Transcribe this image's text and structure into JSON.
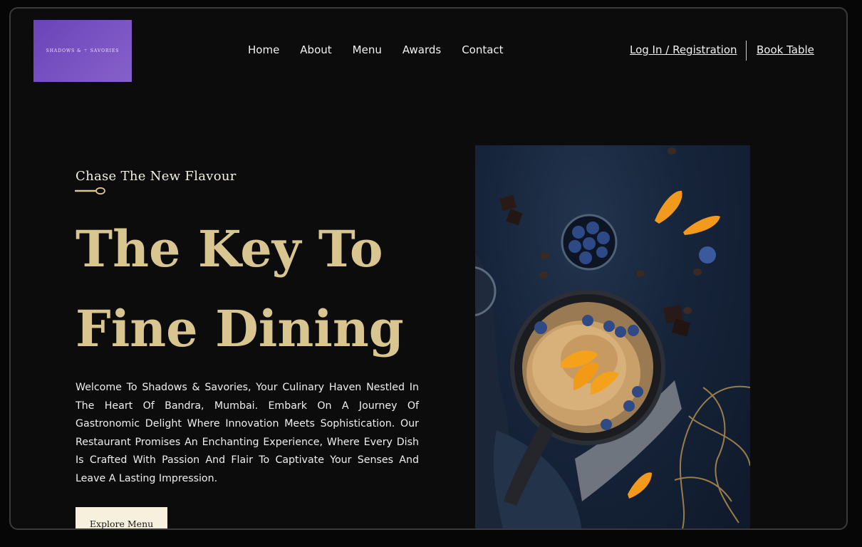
{
  "logo": {
    "text": "SHADOWS & ⚚ SAVORIES",
    "color": "#7450bd"
  },
  "nav": {
    "items": [
      "Home",
      "About",
      "Menu",
      "Awards",
      "Contact"
    ],
    "login_label": "Log In / Registration",
    "book_label": "Book Table"
  },
  "hero": {
    "tagline": "Chase The New Flavour",
    "headline_line1": "The Key To",
    "headline_line2": "Fine Dining",
    "description": "Welcome To Shadows & Savories, Your Culinary Haven Nestled In The Heart Of Bandra, Mumbai. Embark On A Journey Of Gastronomic Delight Where Innovation Meets Sophistication. Our Restaurant Promises An Enchanting Experience, Where Every Dish Is Crafted With Passion And Flair To Captivate Your Senses And Leave A Lasting Impression.",
    "cta_label": "Explore Menu"
  },
  "colors": {
    "background": "#0c0c0d",
    "gold": "#d9c58f",
    "button_bg": "#f6f0dc",
    "photo_bg": "#16243a"
  },
  "icons": [
    "spoon-icon"
  ]
}
